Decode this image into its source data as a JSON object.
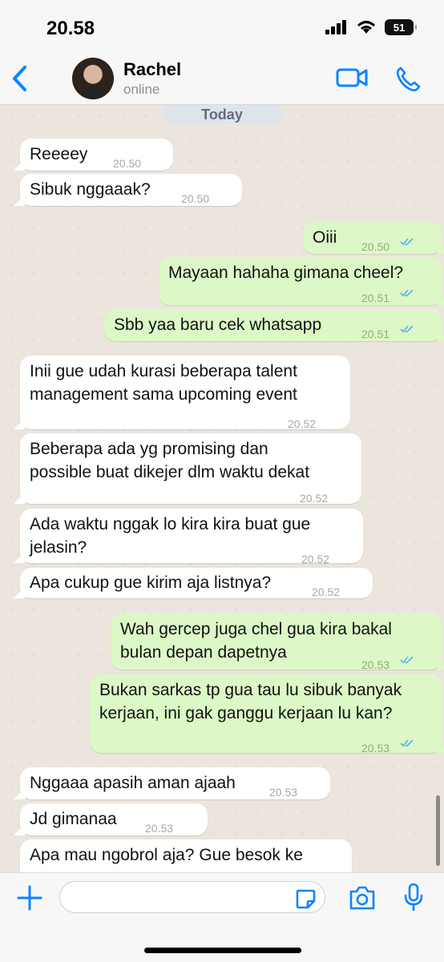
{
  "status": {
    "time": "20.58",
    "battery": "51"
  },
  "header": {
    "name": "Rachel",
    "status": "online"
  },
  "chat": {
    "date": "Today",
    "messages": [
      {
        "dir": "in",
        "text": "Reeeey",
        "time": "20.50"
      },
      {
        "dir": "in",
        "text": "Sibuk nggaaak?",
        "time": "20.50"
      },
      {
        "dir": "out",
        "text": "Oiii",
        "time": "20.50",
        "read": true
      },
      {
        "dir": "out",
        "text": "Mayaan hahaha gimana cheel?",
        "time": "20.51",
        "read": true
      },
      {
        "dir": "out",
        "text": "Sbb yaa baru cek whatsapp",
        "time": "20.51",
        "read": true
      },
      {
        "dir": "in",
        "text": "Inii gue udah kurasi beberapa talent management sama upcoming event",
        "time": "20.52"
      },
      {
        "dir": "in",
        "text": "Beberapa ada yg promising dan possible buat dikejer dlm waktu dekat",
        "time": "20.52"
      },
      {
        "dir": "in",
        "text": "Ada waktu nggak lo kira kira buat gue jelasin?",
        "time": "20.52"
      },
      {
        "dir": "in",
        "text": "Apa cukup gue kirim aja listnya?",
        "time": "20.52"
      },
      {
        "dir": "out",
        "text": "Wah gercep juga chel gua kira bakal bulan depan dapetnya",
        "time": "20.53",
        "read": true
      },
      {
        "dir": "out",
        "text": "Bukan sarkas tp gua tau lu sibuk banyak kerjaan, ini gak ganggu kerjaan lu kan?",
        "time": "20.53",
        "read": true
      },
      {
        "dir": "in",
        "text": "Nggaaa apasih aman ajaah",
        "time": "20.53"
      },
      {
        "dir": "in",
        "text": "Jd gimanaa",
        "time": "20.53"
      },
      {
        "dir": "in",
        "text": "Apa mau ngobrol aja? Gue besok ke",
        "time": ""
      }
    ]
  },
  "composer": {
    "placeholder": ""
  },
  "icons": {
    "back": "chevron-left-icon",
    "video": "video-camera-icon",
    "call": "phone-icon",
    "add": "plus-icon",
    "sticker": "sticker-icon",
    "camera": "camera-icon",
    "mic": "microphone-icon"
  },
  "colors": {
    "accent": "#0a84ff",
    "outgoing": "#dcf8c6",
    "incoming": "#ffffff",
    "read": "#4fb6ec"
  }
}
